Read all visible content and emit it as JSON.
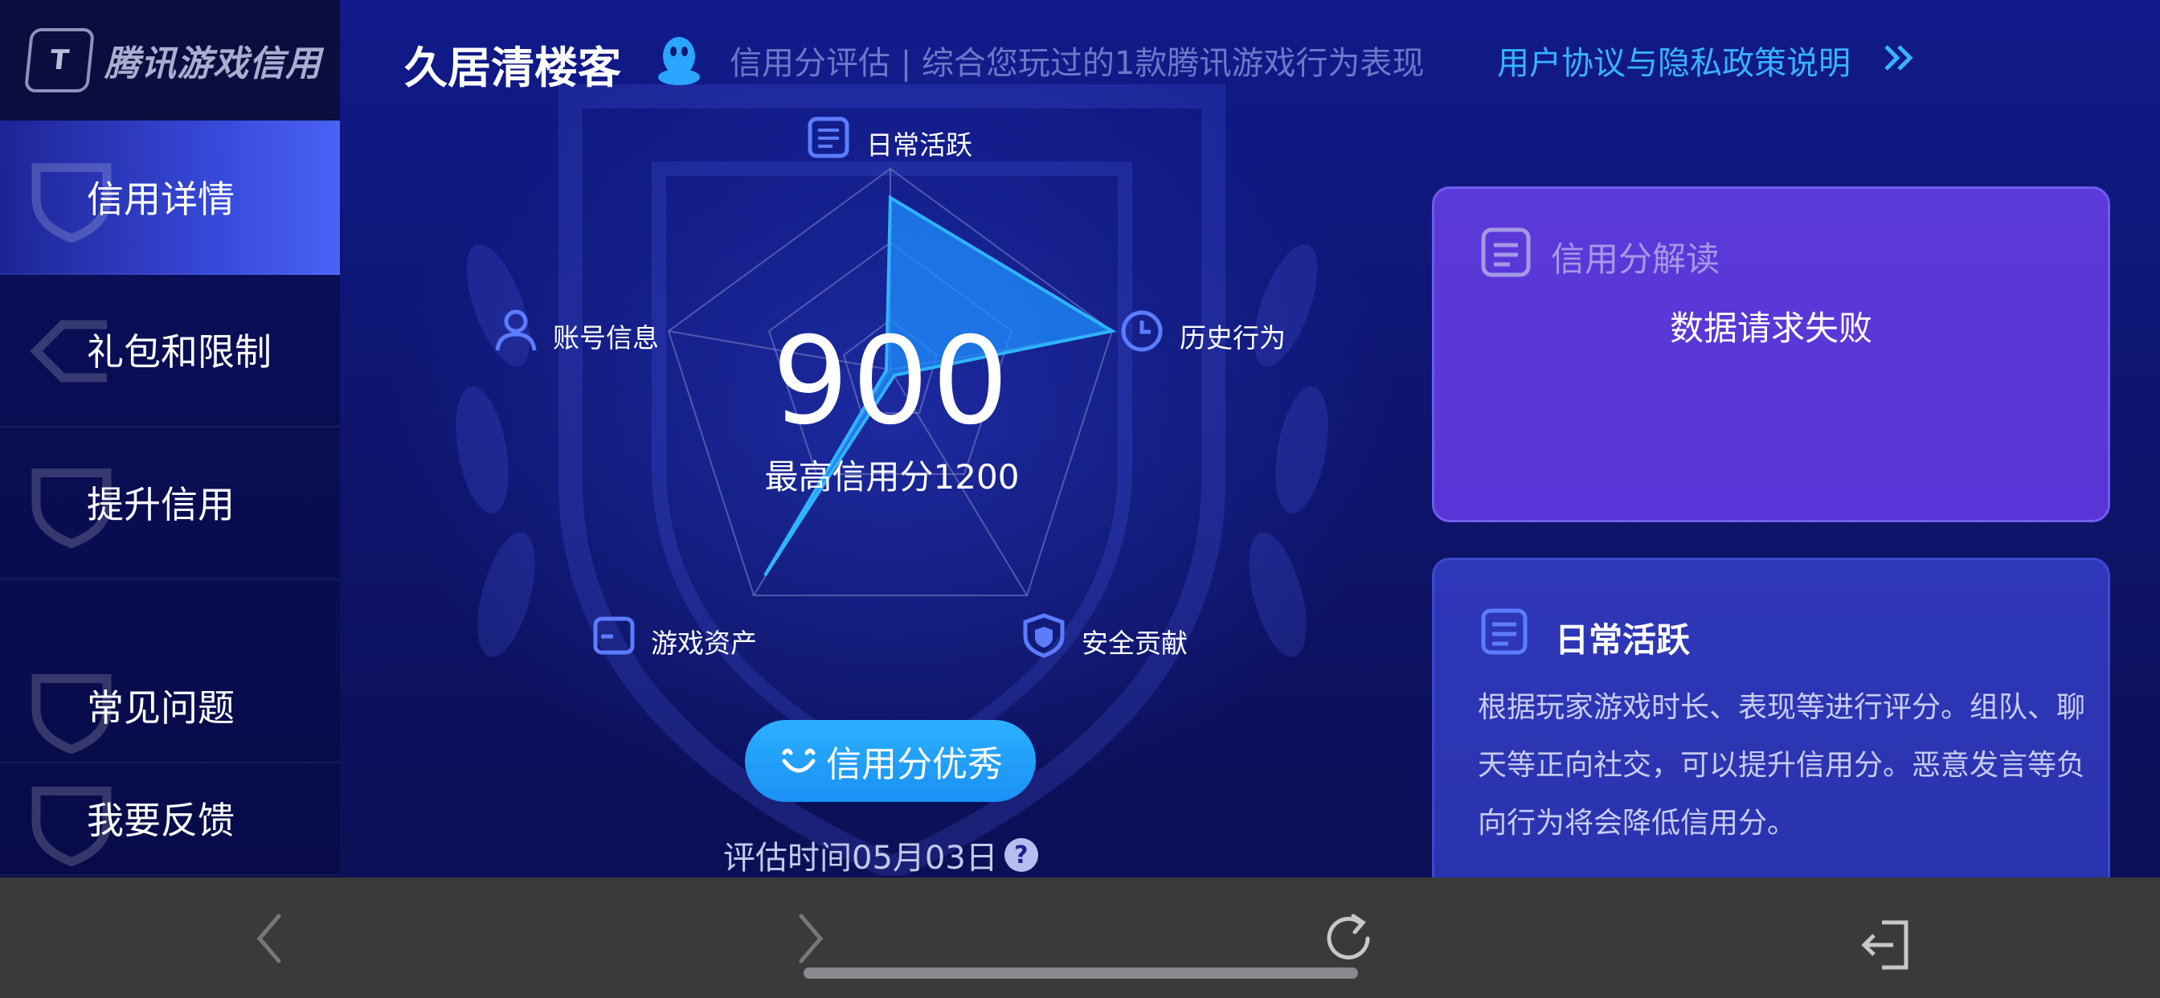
{
  "app": {
    "logo_text": "腾讯游戏信用"
  },
  "sidebar": {
    "items": [
      {
        "label": "信用详情",
        "active": true
      },
      {
        "label": "礼包和限制",
        "active": false
      },
      {
        "label": "提升信用",
        "active": false
      },
      {
        "label": "常见问题",
        "active": false
      },
      {
        "label": "我要反馈",
        "active": false
      }
    ]
  },
  "header": {
    "player_name": "久居清楼客",
    "description": "信用分评估 | 综合您玩过的1款腾讯游戏行为表现",
    "policy_link": "用户协议与隐私政策说明"
  },
  "radar": {
    "score": "900",
    "max_label": "最高信用分1200",
    "dimensions": {
      "daily": "日常活跃",
      "history": "历史行为",
      "security": "安全贡献",
      "assets": "游戏资产",
      "account": "账号信息"
    },
    "level": "信用分优秀",
    "eval_time": "评估时间05月03日",
    "help": "?"
  },
  "cards": {
    "interpret": {
      "title": "信用分解读",
      "message": "数据请求失败"
    },
    "daily": {
      "title": "日常活跃",
      "body": "根据玩家游戏时长、表现等进行评分。组队、聊天等正向社交，可以提升信用分。恶意发言等负向行为将会降低信用分。"
    }
  },
  "colors": {
    "accent_blue": "#2bb0ff",
    "link_blue": "#38b4ff",
    "card_purple": "#5a3ad8",
    "card_blue": "#2e37b8",
    "background": "#0e1570"
  }
}
